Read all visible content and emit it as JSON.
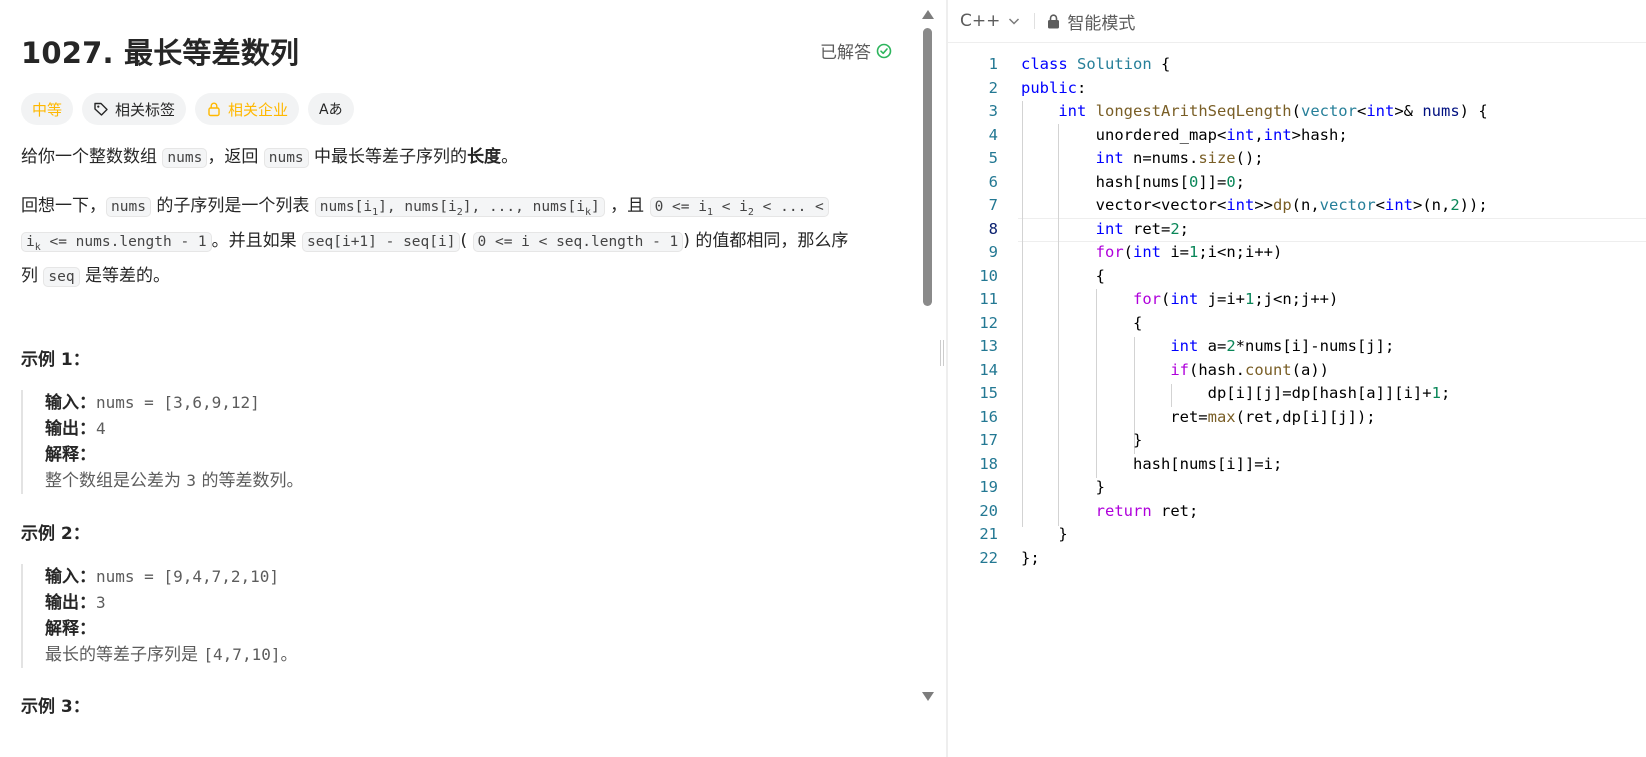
{
  "problem": {
    "title": "1027. 最长等差数列",
    "status": "已解答",
    "tags": {
      "difficulty": "中等",
      "related_tags": "相关标签",
      "related_companies": "相关企业",
      "translate_icon": "Aあ"
    },
    "desc1": {
      "p1": "给你一个整数数组 ",
      "c1": "nums",
      "p2": "，返回 ",
      "c2": "nums",
      "p3": " 中最长等差子序列的",
      "bold": "长度",
      "p4": "。"
    },
    "desc2": {
      "p1": "回想一下，",
      "c1": "nums",
      "p2": " 的子序列是一个列表 ",
      "c2a": "nums[i",
      "c2s1": "1",
      "c2b": "], nums[i",
      "c2s2": "2",
      "c2c": "], ..., nums[i",
      "c2s3": "k",
      "c2d": "]",
      "p3": " ，且 ",
      "c3a": "0 <= i",
      "c3s1": "1",
      "c3b": " < i",
      "c3s2": "2",
      "c3c": " < ... <",
      "c4a": "i",
      "c4s": "k",
      "c4b": " <= nums.length - 1",
      "p4": "。并且如果 ",
      "c5": "seq[i+1] - seq[i]",
      "p5": "( ",
      "c6": "0 <= i < seq.length - 1",
      "p6": ") 的值都相同，那么序",
      "p7": "列 ",
      "c7": "seq",
      "p8": " 是等差的。"
    },
    "examples": [
      {
        "title": "示例 1：",
        "input_label": "输入：",
        "input": "nums = [3,6,9,12]",
        "output_label": "输出：",
        "output": "4",
        "explain_label": "解释：",
        "explain_pre": "整个数组是公差为 ",
        "explain_code": "3",
        "explain_post": " 的等差数列。"
      },
      {
        "title": "示例 2：",
        "input_label": "输入：",
        "input": "nums = [9,4,7,2,10]",
        "output_label": "输出：",
        "output": "3",
        "explain_label": "解释：",
        "explain_pre": "最长的等差子序列是 ",
        "explain_code": "[4,7,10]",
        "explain_post": "。"
      },
      {
        "title": "示例 3："
      }
    ]
  },
  "editor": {
    "language": "C++",
    "mode": "智能模式",
    "current_line": 8
  },
  "colors": {
    "accent_medium": "#ffb800",
    "solved_green": "#2db55d",
    "line_number": "#237893",
    "keyword": "#0000ff",
    "type": "#267f99",
    "function": "#795e26",
    "number": "#098658",
    "control": "#af00db"
  }
}
